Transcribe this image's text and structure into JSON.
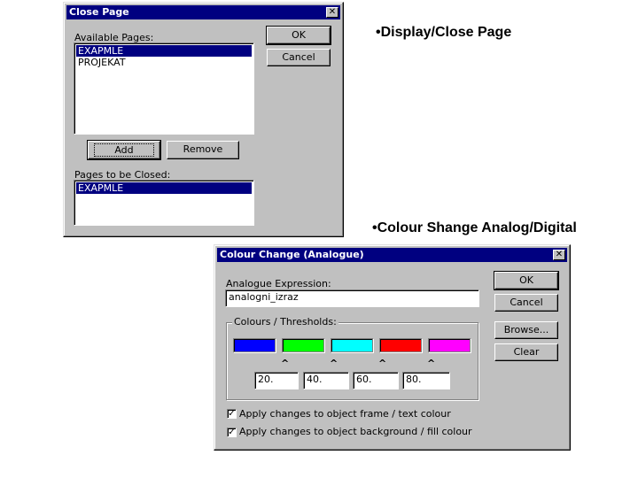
{
  "slide": {
    "label1": "•Display/Close Page",
    "label2": "•Colour Shange Analog/Digital"
  },
  "close_page_dialog": {
    "title": "Close Page",
    "close_glyph": "✕",
    "available_label": "Available Pages:",
    "available_items": [
      "EXAPMLE",
      "PROJEKAT"
    ],
    "available_selected_index": 0,
    "ok_label": "OK",
    "cancel_label": "Cancel",
    "add_label": "Add",
    "remove_label": "Remove",
    "closed_label": "Pages to be Closed:",
    "closed_items": [
      "EXAPMLE"
    ]
  },
  "colour_dialog": {
    "title": "Colour Change (Analogue)",
    "close_glyph": "✕",
    "expression_label": "Analogue Expression:",
    "expression_value": "analogni_izraz",
    "thresholds_legend": "Colours / Thresholds:",
    "colours": [
      "#0000ff",
      "#00ff00",
      "#00ffff",
      "#ff0000",
      "#ff00ff"
    ],
    "caret_glyph": "^",
    "thresholds": [
      "20.",
      "40.",
      "60.",
      "80."
    ],
    "ok_label": "OK",
    "cancel_label": "Cancel",
    "browse_label": "Browse...",
    "clear_label": "Clear",
    "check_glyph": "✓",
    "checkbox1_label": "Apply changes to object frame / text colour",
    "checkbox1_checked": true,
    "checkbox2_label": "Apply changes to object background / fill colour",
    "checkbox2_checked": true
  }
}
